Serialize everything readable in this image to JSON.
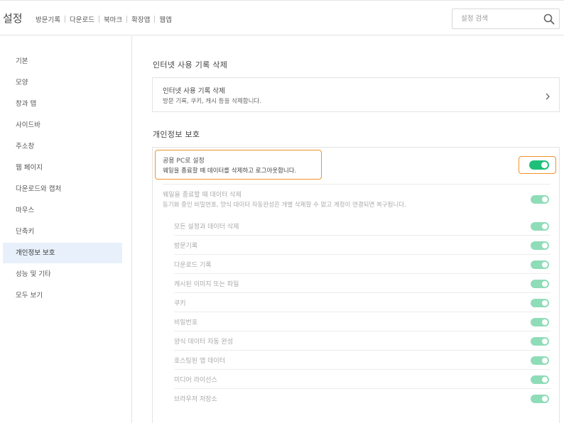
{
  "header": {
    "title": "설정",
    "links": [
      "방문기록",
      "다운로드",
      "북마크",
      "확장앱",
      "웹앱"
    ],
    "search_placeholder": "설정 검색"
  },
  "sidebar": {
    "items": [
      {
        "label": "기본"
      },
      {
        "label": "모양"
      },
      {
        "label": "창과 탭"
      },
      {
        "label": "사이드바"
      },
      {
        "label": "주소창"
      },
      {
        "label": "웹 페이지"
      },
      {
        "label": "다운로드와 캡처"
      },
      {
        "label": "마우스"
      },
      {
        "label": "단축키"
      },
      {
        "label": "개인정보 보호",
        "active": true
      },
      {
        "label": "성능 및 기타"
      },
      {
        "label": "모두 보기"
      }
    ]
  },
  "main": {
    "section1": {
      "title": "인터넷 사용 기록 삭제",
      "row_title": "인터넷 사용 기록 삭제",
      "row_desc": "방문 기록, 쿠키, 캐시 등을 삭제합니다."
    },
    "section2": {
      "title": "개인정보 보호",
      "public_pc": {
        "title": "공용 PC로 설정",
        "desc": "웨일을 종료할 때 데이터를 삭제하고 로그아웃합니다.",
        "enabled": true
      },
      "on_exit": {
        "title": "웨일을 종료할 때 데이터 삭제",
        "desc": "동기화 중인 비밀번호, 양식 데이터 자동완성은 개별 삭제할 수 없고 계정이 연결되면 복구됩니다.",
        "enabled": true
      },
      "items": [
        {
          "label": "모든 설정과 데이터 삭제",
          "enabled": true
        },
        {
          "label": "방문기록",
          "enabled": true
        },
        {
          "label": "다운로드 기록",
          "enabled": true
        },
        {
          "label": "캐시된 이미지 또는 파일",
          "enabled": true
        },
        {
          "label": "쿠키",
          "enabled": true
        },
        {
          "label": "비밀번호",
          "enabled": true
        },
        {
          "label": "양식 데이터 자동 완성",
          "enabled": true
        },
        {
          "label": "호스팅된 앱 데이터",
          "enabled": true
        },
        {
          "label": "미디어 라이선스",
          "enabled": true
        },
        {
          "label": "브라우저 저장소",
          "enabled": true
        }
      ]
    }
  },
  "colors": {
    "toggle_on": "#26c281",
    "highlight": "#f0932b",
    "active_nav": "#e8f1fb"
  }
}
